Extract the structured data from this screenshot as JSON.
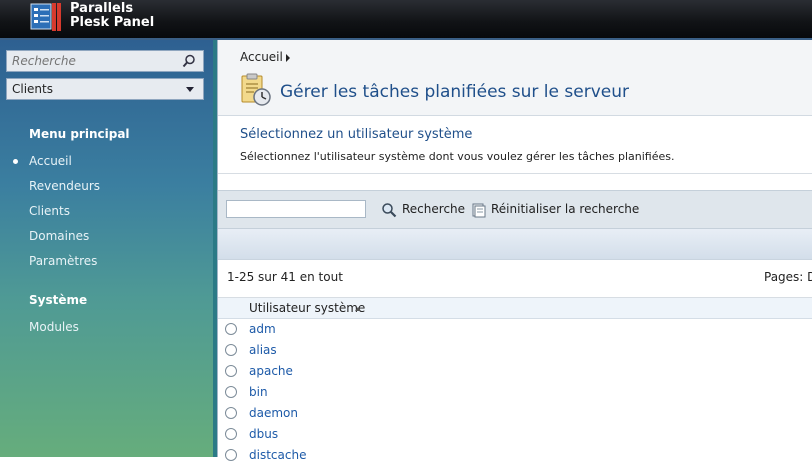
{
  "header": {
    "brand_line1": "Parallels",
    "brand_line2": "Plesk Panel",
    "colors": {
      "bar": "#0d0f12",
      "logo_blue": "#2c6fb7",
      "logo_red": "#d63a2e"
    }
  },
  "sidebar": {
    "search_placeholder": "Recherche",
    "select_value": "Clients",
    "main_menu_heading": "Menu principal",
    "items": [
      {
        "label": "Accueil",
        "active": true
      },
      {
        "label": "Revendeurs"
      },
      {
        "label": "Clients"
      },
      {
        "label": "Domaines"
      },
      {
        "label": "Paramètres"
      }
    ],
    "system_heading": "Système",
    "system_items": [
      {
        "label": "Modules"
      }
    ]
  },
  "main": {
    "breadcrumb": "Accueil",
    "page_title": "Gérer les tâches planifiées sur le serveur",
    "section_title": "Sélectionnez un utilisateur système",
    "section_desc": "Sélectionnez l'utilisateur système dont vous voulez gérer les tâches planifiées.",
    "filter": {
      "search_value": "",
      "search_label": "Recherche",
      "reset_label": "Réinitialiser la recherche"
    },
    "count_text": "1-25 sur 41 en tout",
    "pages_text": "Pages: Dé",
    "table": {
      "column": "Utilisateur système",
      "rows": [
        "adm",
        "alias",
        "apache",
        "bin",
        "daemon",
        "dbus",
        "distcache"
      ]
    }
  }
}
